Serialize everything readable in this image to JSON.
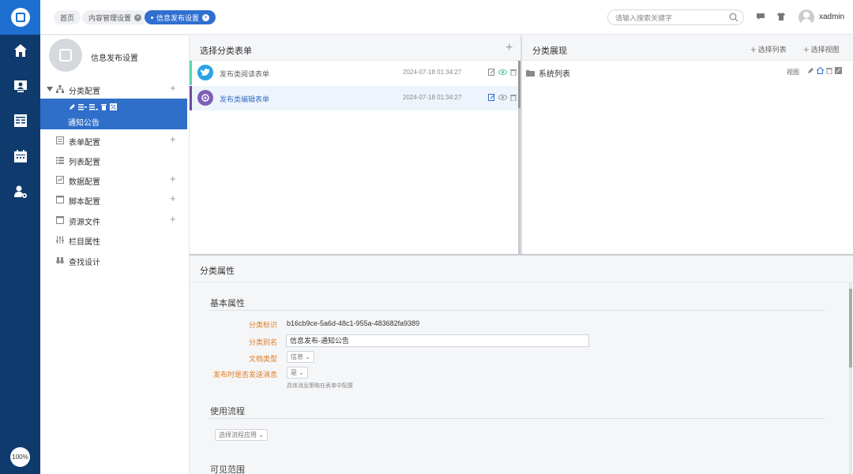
{
  "topbar": {
    "tabs": [
      {
        "label": "首页"
      },
      {
        "label": "内容管理设置"
      },
      {
        "label": "信息发布设置"
      }
    ],
    "search_placeholder": "请输入搜索关键字",
    "username": "xadmin"
  },
  "rail": {
    "zoom": "100%"
  },
  "leftpanel": {
    "title": "信息发布设置",
    "items": [
      {
        "label": "分类配置"
      },
      {
        "label": "通知公告"
      },
      {
        "label": "表单配置"
      },
      {
        "label": "列表配置"
      },
      {
        "label": "数据配置"
      },
      {
        "label": "脚本配置"
      },
      {
        "label": "资源文件"
      },
      {
        "label": "栏目属性"
      },
      {
        "label": "查找设计"
      }
    ]
  },
  "center": {
    "title": "选择分类表单",
    "forms": [
      {
        "name": "发布类阅读表单",
        "time": "2024-07-18 01:34:27"
      },
      {
        "name": "发布类编辑表单",
        "time": "2024-07-18 01:34:27"
      }
    ]
  },
  "right": {
    "title": "分类展现",
    "select_list": "选择列表",
    "select_view": "选择视图",
    "item": "系统列表",
    "view_tag": "视图"
  },
  "props": {
    "title": "分类属性",
    "basic": "基本属性",
    "fields": {
      "id_label": "分类标识",
      "id_value": "b16cb9ce-5a6d-48c1-955a-483682fa9389",
      "alias_label": "分类别名",
      "alias_value": "信息发布-通知公告",
      "doctype_label": "文档类型",
      "doctype_value": "信息",
      "send_label": "发布时是否发送消息",
      "send_value": "是",
      "send_hint": "具体消息策略在表单中配置"
    },
    "flow": "使用流程",
    "flow_select": "选择流程应用",
    "visible": "可见范围"
  }
}
